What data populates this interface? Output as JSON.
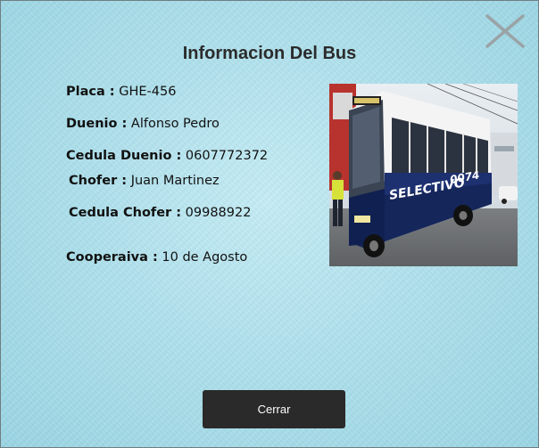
{
  "modal": {
    "title": "Informacion Del Bus",
    "close_icon": "close-icon"
  },
  "fields": {
    "placa": {
      "label": "Placa :",
      "value": "GHE-456"
    },
    "duenio": {
      "label": "Duenio :",
      "value": "Alfonso Pedro"
    },
    "cedula_duenio": {
      "label": "Cedula Duenio :",
      "value": "0607772372"
    },
    "chofer": {
      "label": "Chofer :",
      "value": "Juan Martinez"
    },
    "cedula_chofer": {
      "label": "Cedula Chofer :",
      "value": "09988922"
    },
    "cooperativa": {
      "label": "Cooperaiva :",
      "value": "10 de Agosto"
    }
  },
  "photo": {
    "bus_lettering": "SELECTIVO",
    "bus_number": "0074"
  },
  "footer": {
    "close_button_label": "Cerrar"
  },
  "colors": {
    "background": "#aee0ec",
    "button_bg": "#2a2a2a",
    "button_text": "#ffffff",
    "close_icon": "#9aa3a6"
  }
}
